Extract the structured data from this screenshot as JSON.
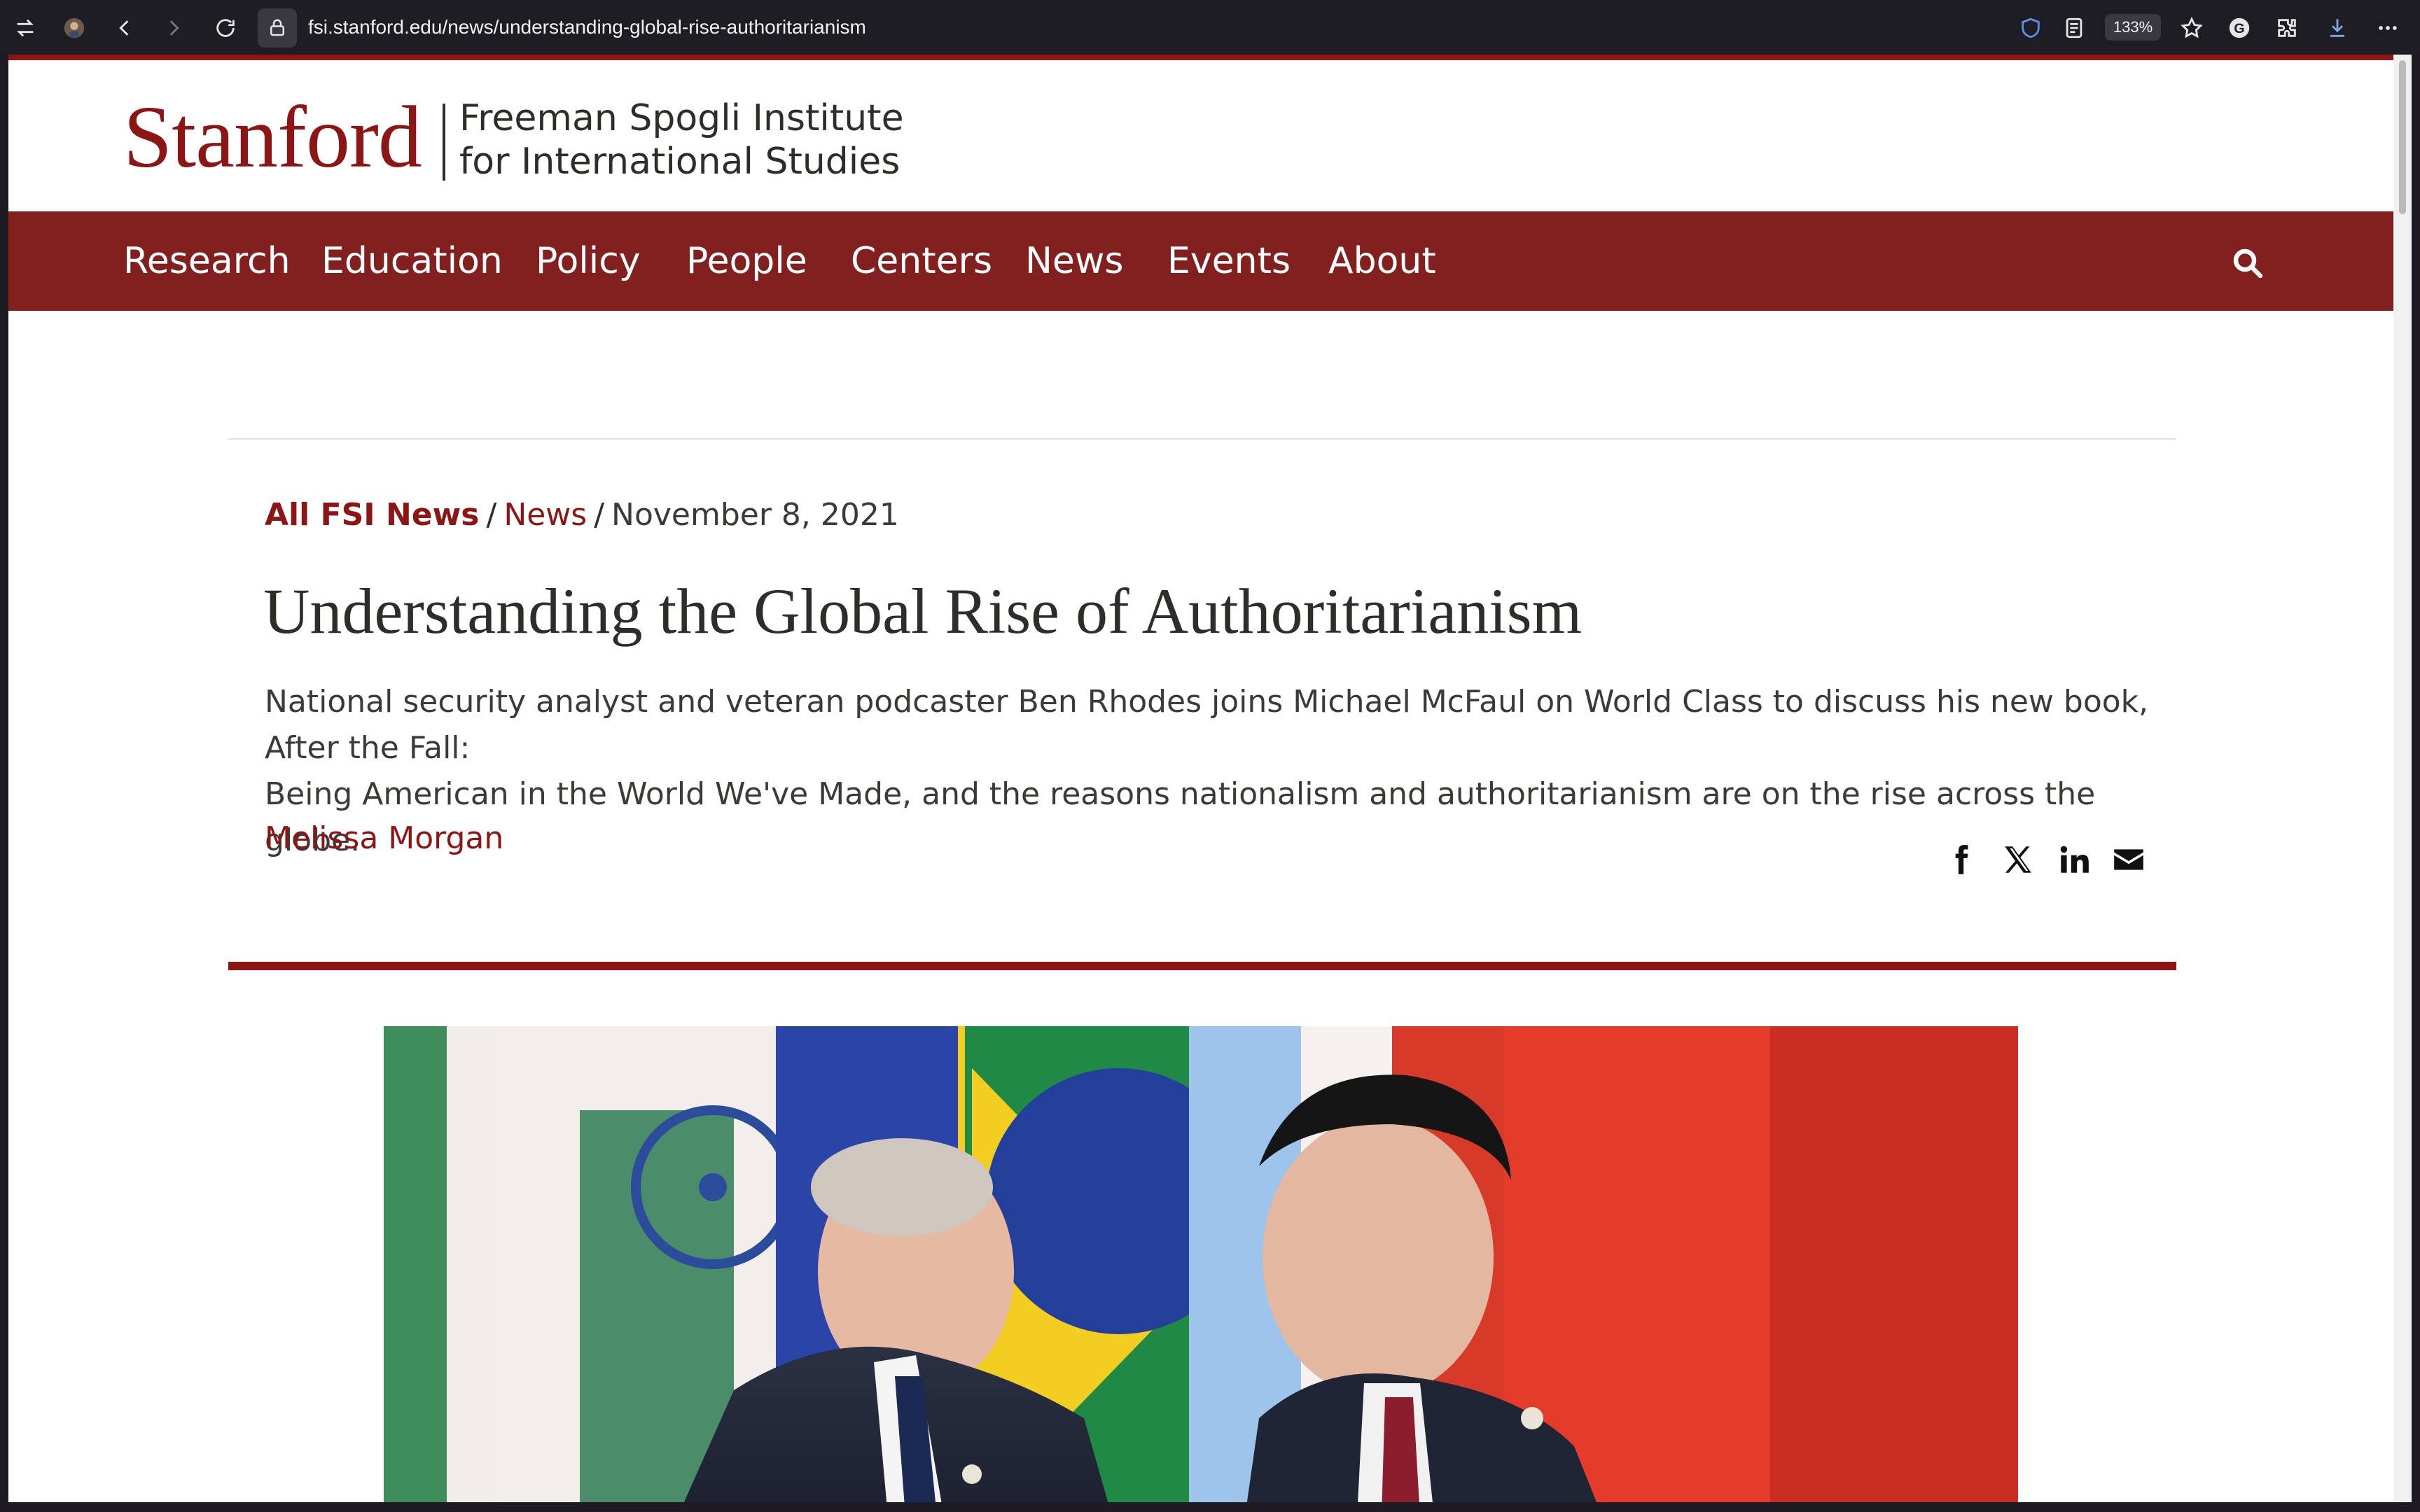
{
  "browser": {
    "url": "fsi.stanford.edu/news/understanding-global-rise-authoritarianism",
    "zoom": "133%"
  },
  "header": {
    "logo_word": "Stanford",
    "logo_line1": "Freeman Spogli Institute",
    "logo_line2": "for International Studies"
  },
  "nav": {
    "items": [
      {
        "label": "Research"
      },
      {
        "label": "Education"
      },
      {
        "label": "Policy"
      },
      {
        "label": "People"
      },
      {
        "label": "Centers"
      },
      {
        "label": "News"
      },
      {
        "label": "Events"
      },
      {
        "label": "About"
      }
    ],
    "search_icon": "search-icon"
  },
  "breadcrumb": {
    "all": "All FSI News",
    "section": "News",
    "sep": "/",
    "date": "November 8, 2021"
  },
  "article": {
    "title": "Understanding the Global Rise of Authoritarianism",
    "dek_line1": "National security analyst and veteran podcaster Ben Rhodes joins Michael McFaul on World Class to discuss his new book, After the Fall:",
    "dek_line2": "Being American in the World We've Made, and the reasons nationalism and authoritarianism are on the rise across the globe.",
    "author": "Melissa Morgan"
  },
  "share": {
    "icons": [
      "facebook-icon",
      "x-icon",
      "linkedin-icon",
      "email-icon"
    ]
  },
  "colors": {
    "cardinal": "#8c1515",
    "nav_bg": "#82201f",
    "text": "#2e2d29"
  }
}
